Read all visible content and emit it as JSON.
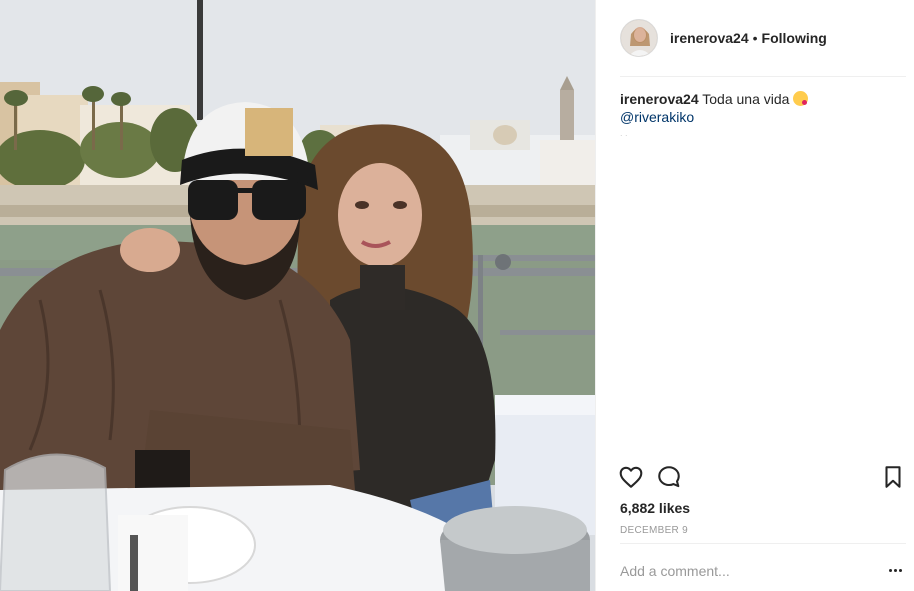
{
  "post": {
    "photo_alt": "",
    "header": {
      "username": "irenerova24",
      "separator": "•",
      "follow_status": "Following"
    },
    "caption": {
      "username": "irenerova24",
      "text": "Toda una vida",
      "emoji": "kissing-face-emoji",
      "mention": "@riverakiko",
      "faint_line": ". ."
    },
    "actions": {
      "like_icon": "heart-icon",
      "comment_icon": "comment-icon",
      "save_icon": "bookmark-icon"
    },
    "likes": "6,882 likes",
    "date": "DECEMBER 9",
    "comment": {
      "placeholder": "Add a comment...",
      "more_icon": "more-options-icon"
    },
    "colors": {
      "text": "#262626",
      "mention": "#003569",
      "muted": "#999999",
      "divider": "#efefef"
    }
  }
}
